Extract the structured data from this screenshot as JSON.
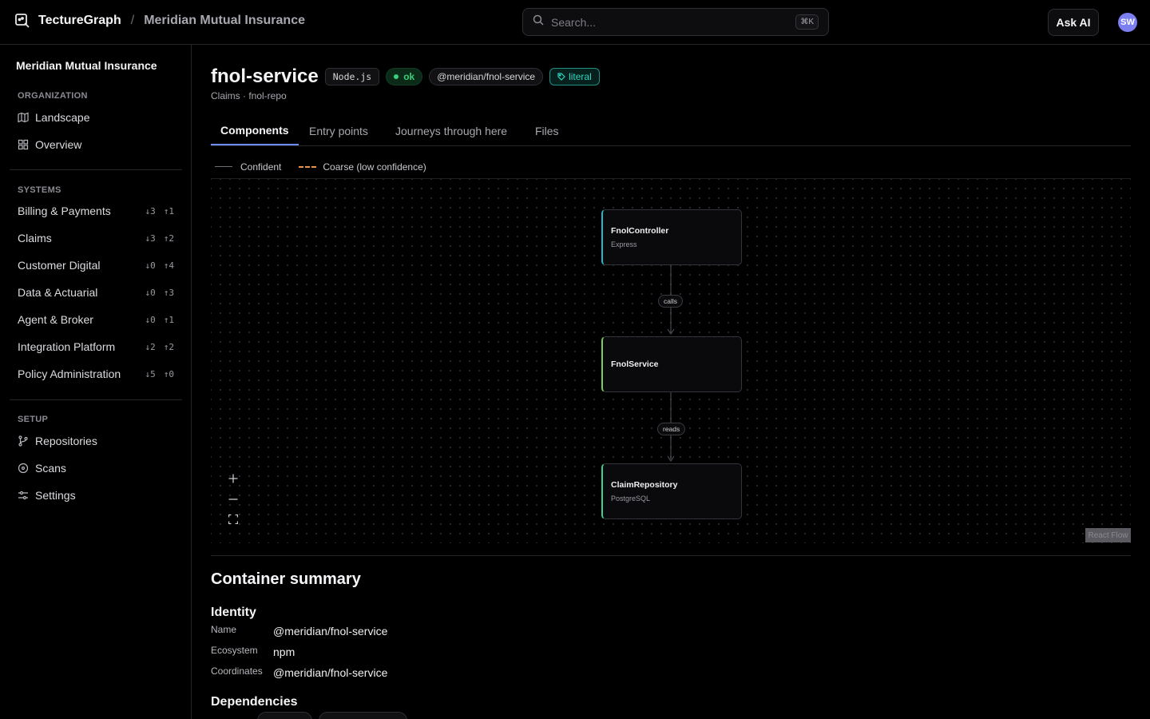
{
  "topbar": {
    "app_name": "TectureGraph",
    "separator": "/",
    "org_name": "Meridian Mutual Insurance",
    "search_placeholder": "Search...",
    "search_shortcut": "⌘K",
    "ask_ai_label": "Ask AI",
    "avatar_initials": "SW"
  },
  "sidebar": {
    "org_title": "Meridian Mutual Insurance",
    "organization_label": "ORGANIZATION",
    "organization_items": [
      {
        "label": "Landscape",
        "icon": "map-icon"
      },
      {
        "label": "Overview",
        "icon": "grid-icon"
      }
    ],
    "systems_label": "SYSTEMS",
    "systems": [
      {
        "label": "Billing & Payments",
        "down": "↓3",
        "up": "↑1"
      },
      {
        "label": "Claims",
        "down": "↓3",
        "up": "↑2"
      },
      {
        "label": "Customer Digital",
        "down": "↓0",
        "up": "↑4"
      },
      {
        "label": "Data & Actuarial",
        "down": "↓0",
        "up": "↑3"
      },
      {
        "label": "Agent & Broker",
        "down": "↓0",
        "up": "↑1"
      },
      {
        "label": "Integration Platform",
        "down": "↓2",
        "up": "↑2"
      },
      {
        "label": "Policy Administration",
        "down": "↓5",
        "up": "↑0"
      }
    ],
    "setup_label": "SETUP",
    "setup_items": [
      {
        "label": "Repositories",
        "icon": "branch-icon"
      },
      {
        "label": "Scans",
        "icon": "scan-icon"
      },
      {
        "label": "Settings",
        "icon": "settings-icon"
      }
    ]
  },
  "header": {
    "title": "fnol-service",
    "runtime_badge": "Node.js",
    "status_badge": "ok",
    "package_badge": "@meridian/fnol-service",
    "literal_badge": "literal",
    "subtitle": "Claims · fnol-repo",
    "colors": {
      "ok": "#36d07a",
      "literal": "#2dd4bf",
      "accent": "#6c8cff"
    }
  },
  "tabs": [
    {
      "label": "Components",
      "active": true
    },
    {
      "label": "Entry points",
      "active": false
    },
    {
      "label": "Journeys through here",
      "active": false
    },
    {
      "label": "Files",
      "active": false
    }
  ],
  "legend": {
    "confident": "Confident",
    "coarse": "Coarse (low confidence)"
  },
  "graph": {
    "nodes": [
      {
        "name": "FnolController",
        "tech": "Express",
        "accent": "#22b8cf"
      },
      {
        "name": "FnolService",
        "tech": "",
        "accent": "#7ccf5a"
      },
      {
        "name": "ClaimRepository",
        "tech": "PostgreSQL",
        "accent": "#3fcf8e"
      }
    ],
    "edges": [
      {
        "from": "FnolController",
        "to": "FnolService",
        "label": "calls"
      },
      {
        "from": "FnolService",
        "to": "ClaimRepository",
        "label": "reads"
      }
    ],
    "attribution": "React Flow"
  },
  "summary": {
    "title": "Container summary",
    "identity_heading": "Identity",
    "identity": [
      {
        "key": "Name",
        "value": "@meridian/fnol-service"
      },
      {
        "key": "Ecosystem",
        "value": "npm"
      },
      {
        "key": "Coordinates",
        "value": "@meridian/fnol-service"
      }
    ],
    "dependencies_heading": "Dependencies"
  }
}
